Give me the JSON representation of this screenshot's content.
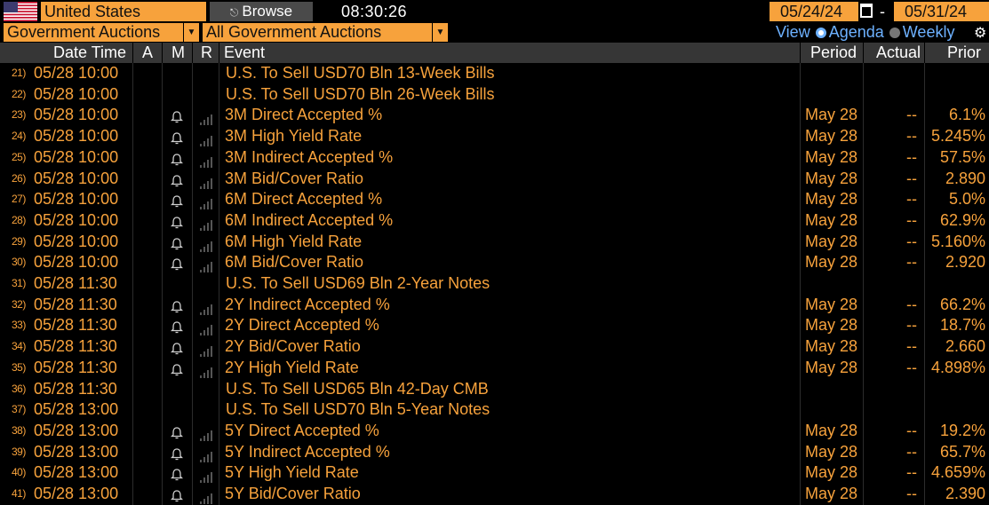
{
  "topbar": {
    "country": "United States",
    "browse_label": "Browse",
    "time": "08:30:26",
    "start_date": "05/24/24",
    "date_sep": "-",
    "end_date": "05/31/24"
  },
  "filters": {
    "category": "Government Auctions",
    "subcategory": "All Government Auctions",
    "view_label": "View",
    "view_options": [
      "Agenda",
      "Weekly"
    ]
  },
  "columns": {
    "datetime": "Date Time",
    "a": "A",
    "m": "M",
    "r": "R",
    "event": "Event",
    "period": "Period",
    "actual": "Actual",
    "prior": "Prior"
  },
  "rows": [
    {
      "num": "21)",
      "dt": "05/28 10:00",
      "event": "U.S. To Sell USD70 Bln 13-Week Bills",
      "header": true,
      "period": "",
      "actual": "",
      "prior": ""
    },
    {
      "num": "22)",
      "dt": "05/28 10:00",
      "event": "U.S. To Sell USD70 Bln 26-Week Bills",
      "header": true,
      "period": "",
      "actual": "",
      "prior": ""
    },
    {
      "num": "23)",
      "dt": "05/28 10:00",
      "event": "3M Direct Accepted %",
      "header": false,
      "period": "May 28",
      "actual": "--",
      "prior": "6.1%"
    },
    {
      "num": "24)",
      "dt": "05/28 10:00",
      "event": "3M High Yield Rate",
      "header": false,
      "period": "May 28",
      "actual": "--",
      "prior": "5.245%"
    },
    {
      "num": "25)",
      "dt": "05/28 10:00",
      "event": "3M Indirect Accepted %",
      "header": false,
      "period": "May 28",
      "actual": "--",
      "prior": "57.5%"
    },
    {
      "num": "26)",
      "dt": "05/28 10:00",
      "event": "3M Bid/Cover Ratio",
      "header": false,
      "period": "May 28",
      "actual": "--",
      "prior": "2.890"
    },
    {
      "num": "27)",
      "dt": "05/28 10:00",
      "event": "6M Direct Accepted %",
      "header": false,
      "period": "May 28",
      "actual": "--",
      "prior": "5.0%"
    },
    {
      "num": "28)",
      "dt": "05/28 10:00",
      "event": "6M Indirect Accepted %",
      "header": false,
      "period": "May 28",
      "actual": "--",
      "prior": "62.9%"
    },
    {
      "num": "29)",
      "dt": "05/28 10:00",
      "event": "6M High Yield Rate",
      "header": false,
      "period": "May 28",
      "actual": "--",
      "prior": "5.160%"
    },
    {
      "num": "30)",
      "dt": "05/28 10:00",
      "event": "6M Bid/Cover Ratio",
      "header": false,
      "period": "May 28",
      "actual": "--",
      "prior": "2.920"
    },
    {
      "num": "31)",
      "dt": "05/28 11:30",
      "event": "U.S. To Sell USD69 Bln 2-Year Notes",
      "header": true,
      "period": "",
      "actual": "",
      "prior": ""
    },
    {
      "num": "32)",
      "dt": "05/28 11:30",
      "event": "2Y Indirect Accepted %",
      "header": false,
      "period": "May 28",
      "actual": "--",
      "prior": "66.2%"
    },
    {
      "num": "33)",
      "dt": "05/28 11:30",
      "event": "2Y Direct Accepted %",
      "header": false,
      "period": "May 28",
      "actual": "--",
      "prior": "18.7%"
    },
    {
      "num": "34)",
      "dt": "05/28 11:30",
      "event": "2Y Bid/Cover Ratio",
      "header": false,
      "period": "May 28",
      "actual": "--",
      "prior": "2.660"
    },
    {
      "num": "35)",
      "dt": "05/28 11:30",
      "event": "2Y High Yield Rate",
      "header": false,
      "period": "May 28",
      "actual": "--",
      "prior": "4.898%"
    },
    {
      "num": "36)",
      "dt": "05/28 11:30",
      "event": "U.S. To Sell USD65 Bln 42-Day CMB",
      "header": true,
      "period": "",
      "actual": "",
      "prior": ""
    },
    {
      "num": "37)",
      "dt": "05/28 13:00",
      "event": "U.S. To Sell USD70 Bln 5-Year Notes",
      "header": true,
      "period": "",
      "actual": "",
      "prior": ""
    },
    {
      "num": "38)",
      "dt": "05/28 13:00",
      "event": "5Y Direct Accepted %",
      "header": false,
      "period": "May 28",
      "actual": "--",
      "prior": "19.2%"
    },
    {
      "num": "39)",
      "dt": "05/28 13:00",
      "event": "5Y Indirect Accepted %",
      "header": false,
      "period": "May 28",
      "actual": "--",
      "prior": "65.7%"
    },
    {
      "num": "40)",
      "dt": "05/28 13:00",
      "event": "5Y High Yield Rate",
      "header": false,
      "period": "May 28",
      "actual": "--",
      "prior": "4.659%"
    },
    {
      "num": "41)",
      "dt": "05/28 13:00",
      "event": "5Y Bid/Cover Ratio",
      "header": false,
      "period": "May 28",
      "actual": "--",
      "prior": "2.390"
    }
  ],
  "colors": {
    "accent": "#f7a23c",
    "header_bg": "#363636",
    "link_blue": "#6db1ff",
    "background": "#000000"
  },
  "icons": {
    "flag": "us-flag-icon",
    "browse": "lock-icon",
    "calendar": "calendar-icon",
    "alert": "bell-icon",
    "relevance": "signal-bars-icon",
    "settings": "gear-icon"
  }
}
